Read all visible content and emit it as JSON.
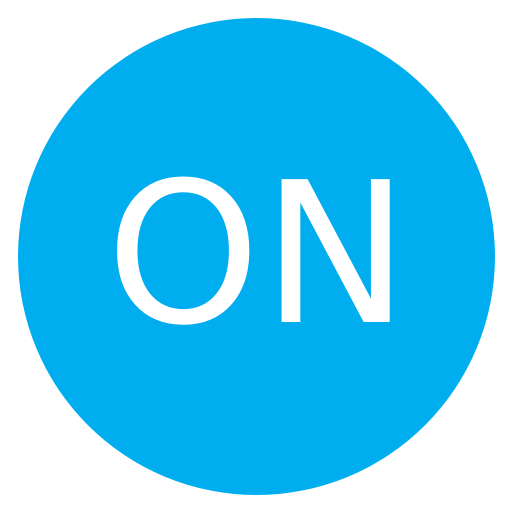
{
  "button": {
    "label": "ON",
    "state": "on"
  },
  "colors": {
    "circle": "#00aeef",
    "text": "#ffffff",
    "background": "#ffffff"
  }
}
